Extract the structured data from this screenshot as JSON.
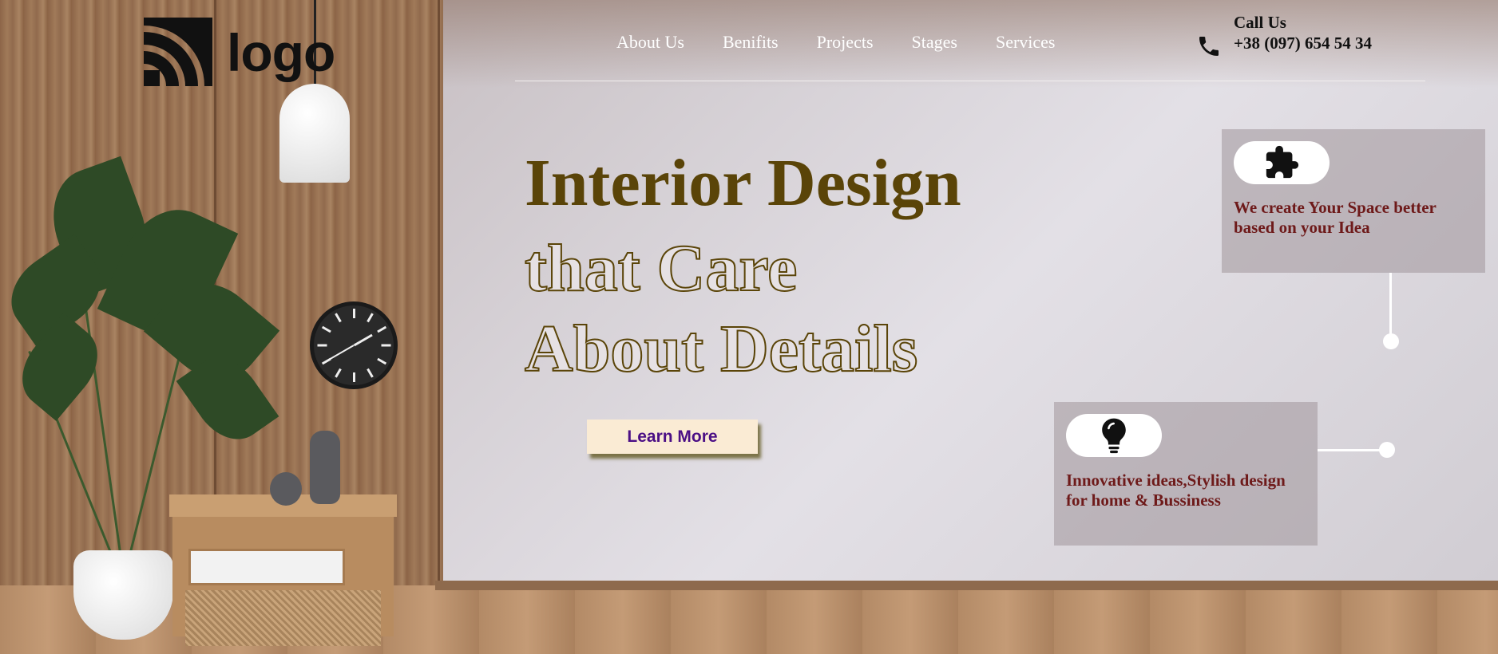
{
  "logo": {
    "text": "logo",
    "icon": "wifi-arcs-logo-icon"
  },
  "nav": {
    "items": [
      {
        "label": "About Us"
      },
      {
        "label": "Benifits"
      },
      {
        "label": "Projects"
      },
      {
        "label": "Stages"
      },
      {
        "label": "Services"
      }
    ]
  },
  "contact": {
    "label": "Call Us",
    "phone": "+38 (097) 654 54 34",
    "icon": "phone-icon"
  },
  "hero": {
    "line1": "Interior Design",
    "line2": "that Care",
    "line3": "About Details",
    "button_label": "Learn More"
  },
  "cards": [
    {
      "icon": "puzzle-icon",
      "text": "We create Your Space better based on your Idea"
    },
    {
      "icon": "lightbulb-icon",
      "text": "Innovative ideas,Stylish design for home & Bussiness"
    }
  ],
  "colors": {
    "hero_text": "#5a4408",
    "button_bg": "#faebd4",
    "button_text": "#4b0f85",
    "card_text": "#6e1a1a",
    "nav_text": "#ffffff"
  }
}
